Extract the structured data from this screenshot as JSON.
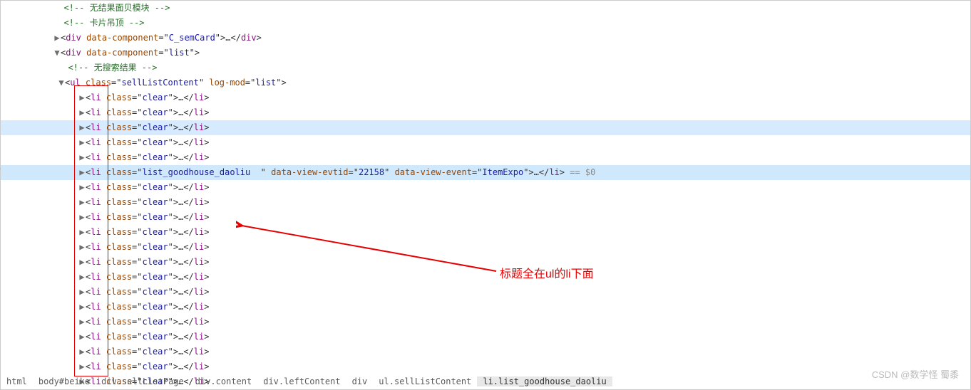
{
  "lines": {
    "comment_truncated": "<!-- 无结果面贝模块 -->",
    "comment_card_top": "<!-- 卡片吊顶 -->",
    "div_semcard": {
      "tag": "div",
      "attr": "data-component",
      "val": "C_semCard"
    },
    "div_list": {
      "tag": "div",
      "attr": "data-component",
      "val": "list"
    },
    "comment_no_result": "<!-- 无搜索结果 -->",
    "ul": {
      "tag": "ul",
      "attr1": "class",
      "val1": "sellListContent",
      "attr2": "log-mod",
      "val2": "list"
    },
    "li_clear": {
      "tag": "li",
      "attr": "class",
      "val": "clear",
      "count_before": 5,
      "count_after": 14
    },
    "li_goodhouse": {
      "tag": "li",
      "attr1": "class",
      "val1": "list_goodhouse_daoliu  ",
      "attr2": "data-view-evtid",
      "val2": "22158",
      "attr3": "data-view-event",
      "val3": "ItemExpo"
    },
    "eq0": " == $0"
  },
  "annotation_text": "标题全在ul的li下面",
  "watermark": "CSDN @数学怪 蜀黍",
  "breadcrumbs": [
    "html",
    "body#beike",
    "div.sellListPage",
    "div.content",
    "div.leftContent",
    "div",
    "ul.sellListContent",
    "li.list_goodhouse_daoliu"
  ]
}
